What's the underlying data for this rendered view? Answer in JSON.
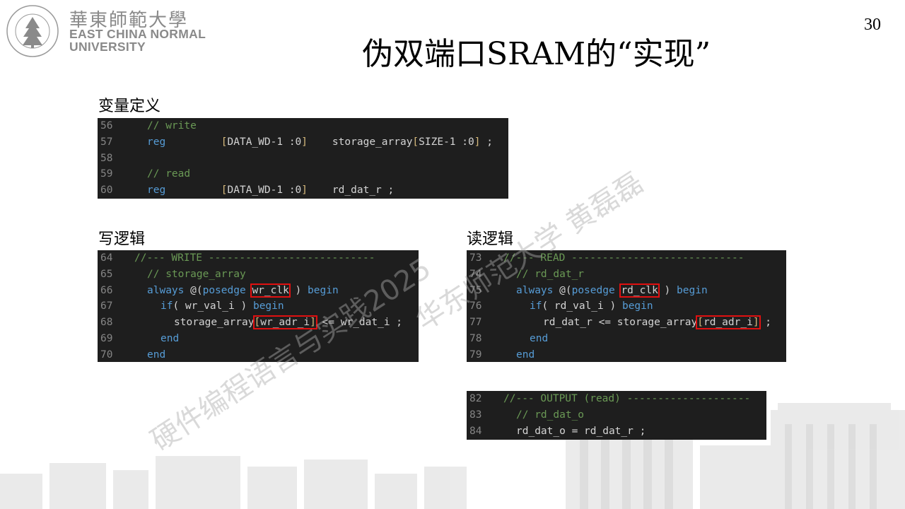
{
  "header": {
    "university_cn": "華東師範大學",
    "university_en_line1": "EAST CHINA NORMAL",
    "university_en_line2": "UNIVERSITY",
    "page_number": "30"
  },
  "title": "伪双端口SRAM的“实现”",
  "sections": {
    "definition_label": "变量定义",
    "write_label": "写逻辑",
    "read_label": "读逻辑"
  },
  "code_definition": {
    "lines": [
      {
        "no": "56",
        "text": "// write"
      },
      {
        "no": "57",
        "text": "reg [DATA_WD-1 :0] storage_array[SIZE-1 :0] ;"
      },
      {
        "no": "58",
        "text": ""
      },
      {
        "no": "59",
        "text": "// read"
      },
      {
        "no": "60",
        "text": "reg [DATA_WD-1 :0] rd_dat_r ;"
      }
    ]
  },
  "code_write": {
    "lines": [
      {
        "no": "64",
        "text": "//--- WRITE ---------------------------"
      },
      {
        "no": "65",
        "text": "// storage_array"
      },
      {
        "no": "66",
        "text": "always @(posedge wr_clk ) begin"
      },
      {
        "no": "67",
        "text": "if( wr_val_i ) begin"
      },
      {
        "no": "68",
        "text": "storage_array[wr_adr_i] <= wr_dat_i ;"
      },
      {
        "no": "69",
        "text": "end"
      },
      {
        "no": "70",
        "text": "end"
      }
    ],
    "highlighted": [
      "wr_clk",
      "wr_adr_i"
    ]
  },
  "code_read": {
    "lines": [
      {
        "no": "73",
        "text": "//--- READ ----------------------------"
      },
      {
        "no": "74",
        "text": "// rd_dat_r"
      },
      {
        "no": "75",
        "text": "always @(posedge rd_clk ) begin"
      },
      {
        "no": "76",
        "text": "if( rd_val_i ) begin"
      },
      {
        "no": "77",
        "text": "rd_dat_r <= storage_array[rd_adr_i] ;"
      },
      {
        "no": "78",
        "text": "end"
      },
      {
        "no": "79",
        "text": "end"
      }
    ],
    "highlighted": [
      "rd_clk",
      "rd_adr_i"
    ]
  },
  "code_output": {
    "lines": [
      {
        "no": "82",
        "text": "//--- OUTPUT (read) --------------------"
      },
      {
        "no": "83",
        "text": "// rd_dat_o"
      },
      {
        "no": "84",
        "text": "rd_dat_o = rd_dat_r ;"
      }
    ]
  },
  "watermark": {
    "line1": "硬件编程语言与实践2025",
    "line2": "华东师范大学 黄磊磊"
  },
  "colors": {
    "code_bg": "#1e1e1e",
    "keyword": "#569cd6",
    "comment": "#6a9955",
    "bracket": "#d7ba7d",
    "highlight_box": "#e01010"
  }
}
